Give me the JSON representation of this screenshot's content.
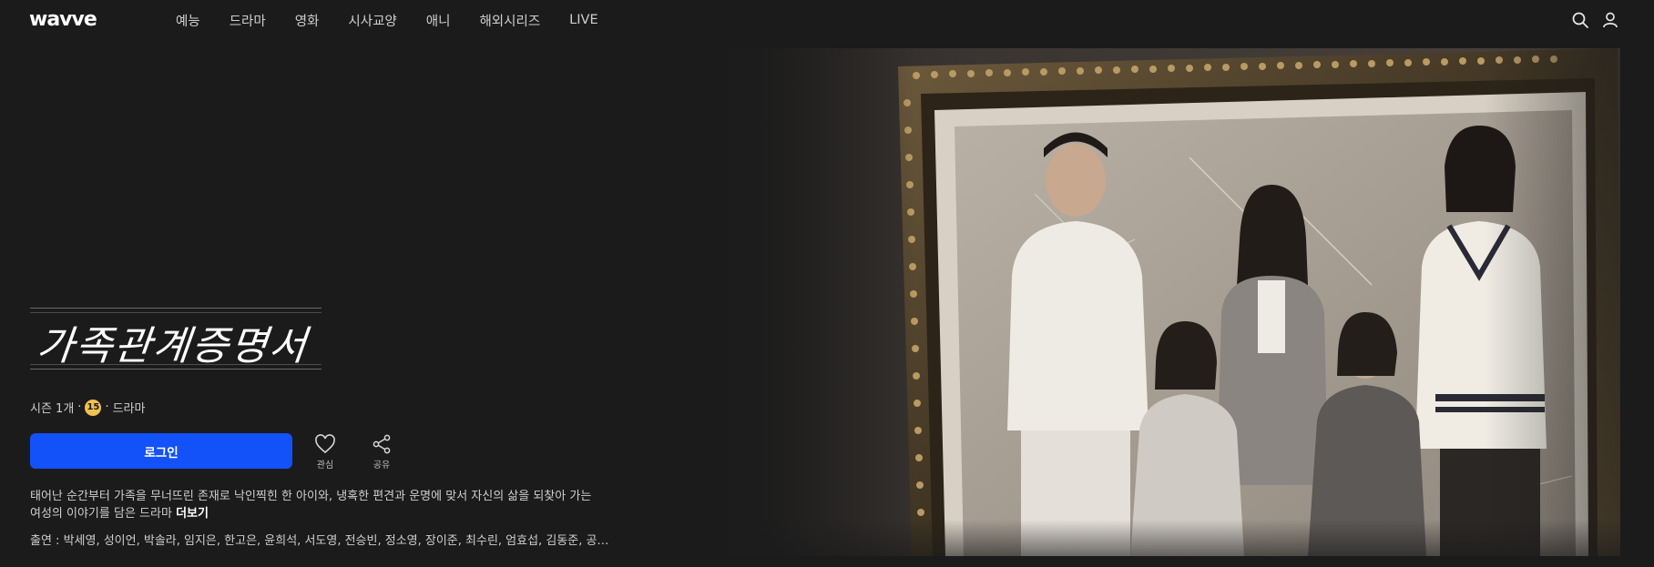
{
  "header": {
    "logo": "wavve",
    "nav": [
      "예능",
      "드라마",
      "영화",
      "시사교양",
      "애니",
      "해외시리즈",
      "LIVE"
    ],
    "icons": [
      "search-icon",
      "user-icon"
    ]
  },
  "show": {
    "title": "가족관계증명서",
    "season": "시즌 1개",
    "age_rating": "15",
    "genre": "드라마",
    "login_label": "로그인",
    "like_label": "관심",
    "share_label": "공유",
    "description": "태어난 순간부터 가족을 무너뜨린 존재로 낙인찍힌 한 아이와, 냉혹한 편견과 운명에 맞서 자신의 삶을 되찾아 가는 여성의 이야기를 담은 드라마",
    "more_label": "더보기",
    "cast_label": "출연 :",
    "cast": "박세영, 성이언, 박솔라, 임지은, 한고은, 윤희석, 서도영, 전승빈, 정소영, 장이준, 최수린, 엄효섭, 김동준, 공…"
  },
  "colors": {
    "background": "#1b1b1b",
    "accent": "#1351f9",
    "age_badge": "#f2c14e"
  }
}
